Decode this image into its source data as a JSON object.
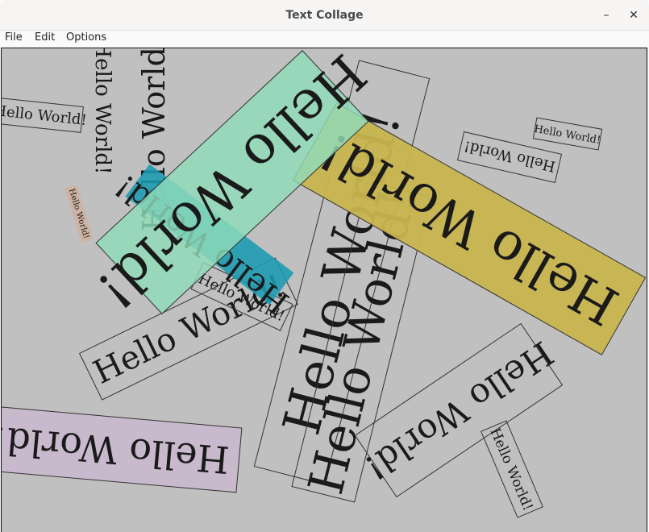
{
  "window": {
    "title": "Text Collage",
    "minimize_glyph": "–",
    "close_glyph": "✕"
  },
  "menu": [
    "File",
    "Edit",
    "Options"
  ],
  "collage": {
    "text": "Hello World!",
    "colors": {
      "canvas": "#c0c0c0",
      "green": "#8fdcb8",
      "yellow": "#c8b44e",
      "teal": "#1a9ab2",
      "purple": "#c9b9cd",
      "tan": "#cdb3a3"
    }
  }
}
